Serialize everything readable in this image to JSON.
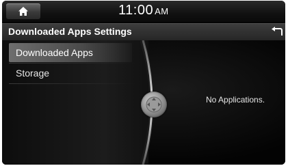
{
  "status_bar": {
    "home_icon": "home-icon",
    "time": "11:00",
    "ampm": "AM"
  },
  "header": {
    "title": "Downloaded Apps Settings",
    "back_icon": "back-arrow-icon"
  },
  "menu": {
    "items": [
      {
        "label": "Downloaded Apps",
        "selected": true
      },
      {
        "label": "Storage",
        "selected": false
      }
    ]
  },
  "content": {
    "message": "No Applications."
  },
  "colors": {
    "background": "#050505",
    "text": "#ffffff",
    "selected_highlight": "#6e6e6e"
  }
}
